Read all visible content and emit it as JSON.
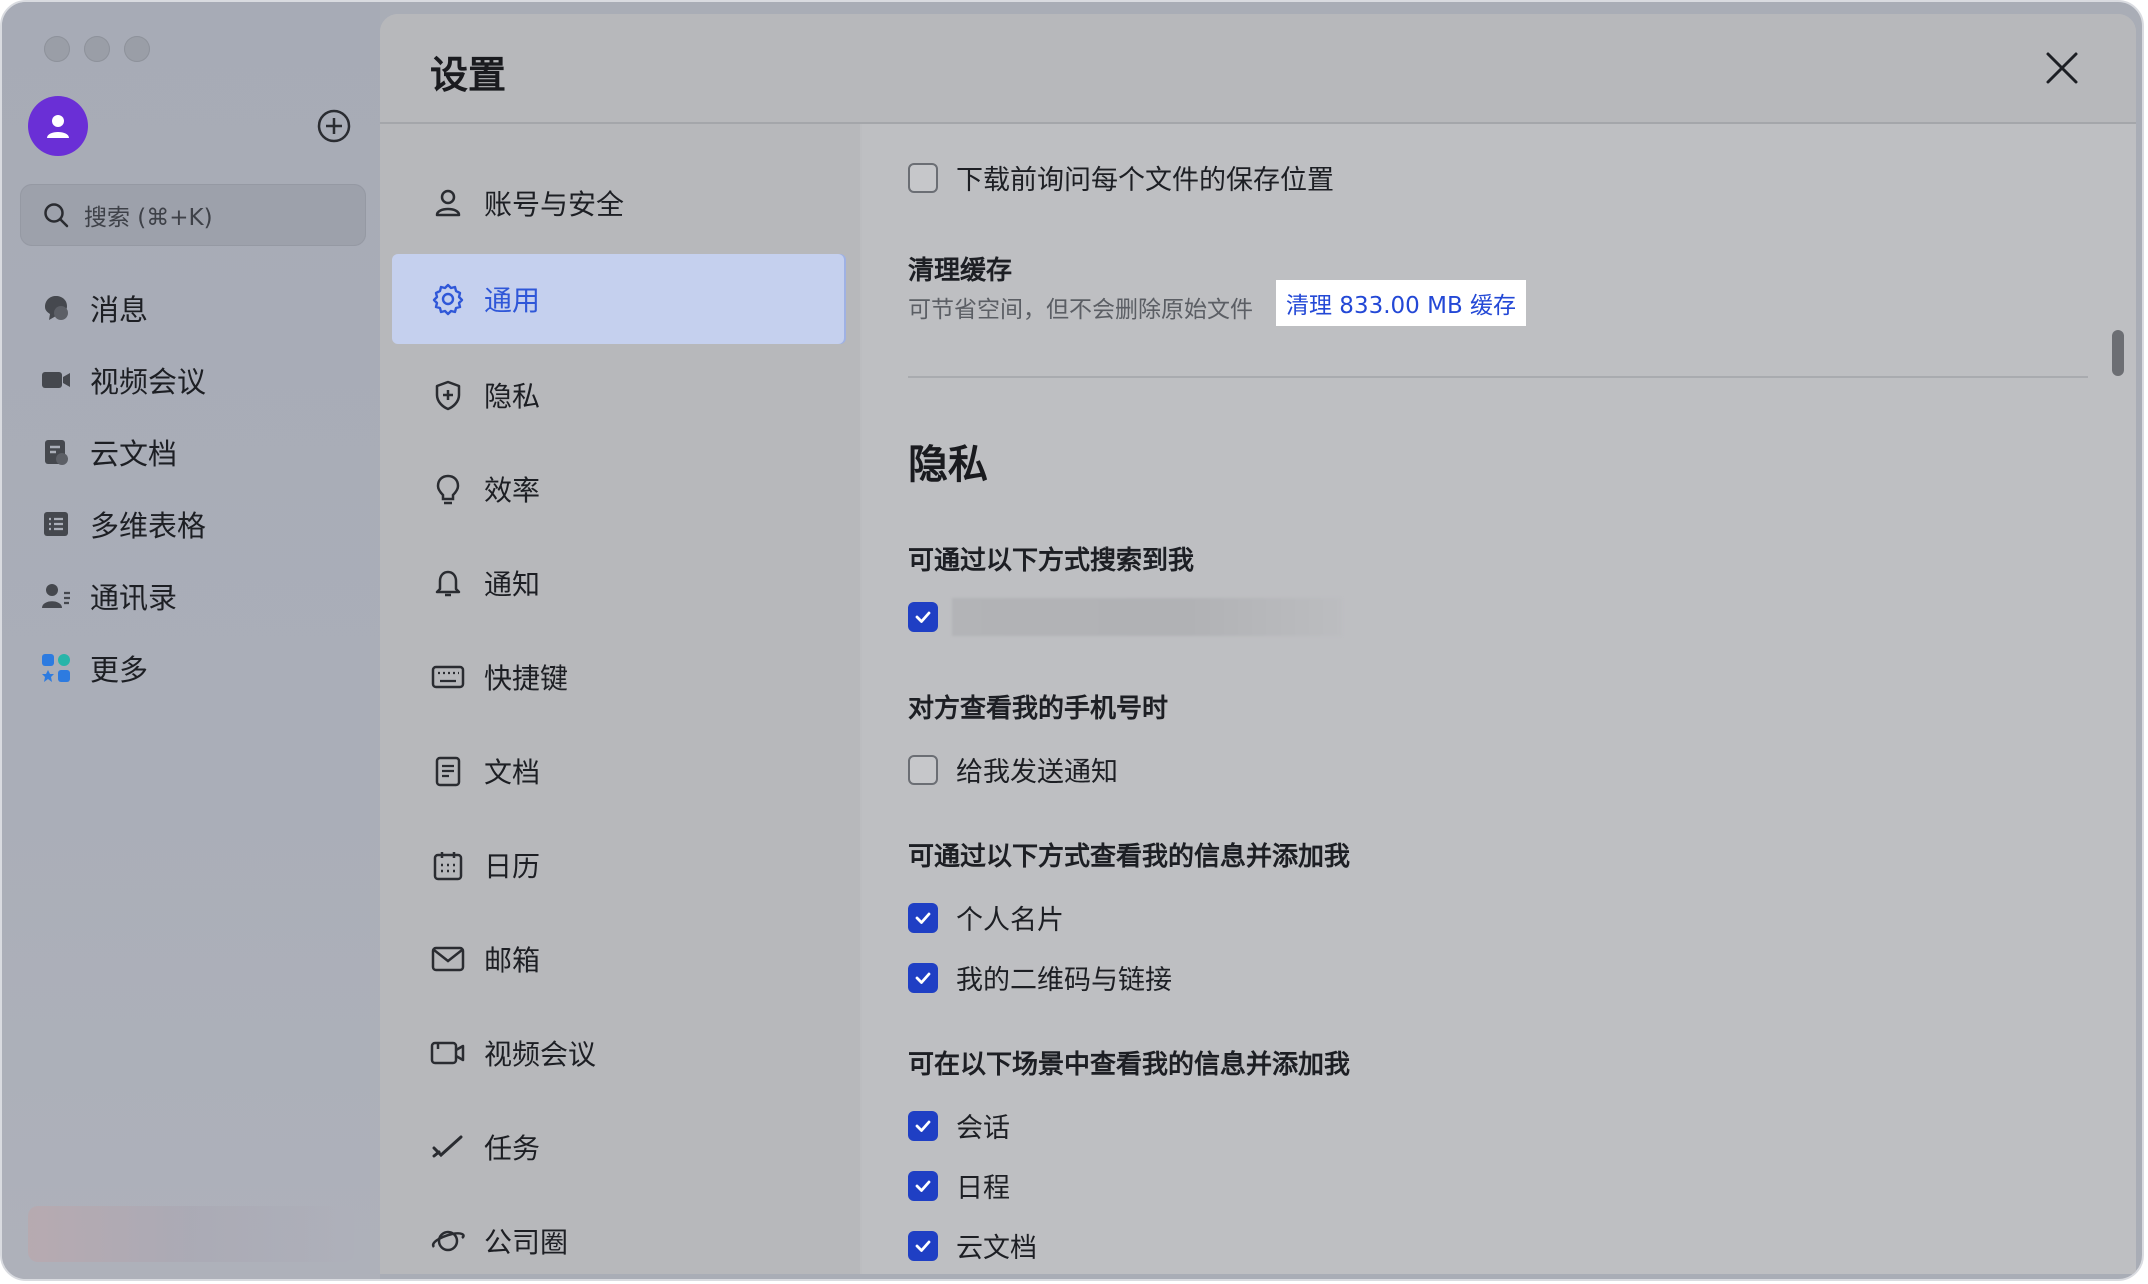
{
  "app": {
    "search_placeholder": "搜索 (⌘+K)",
    "nav": [
      {
        "label": "消息",
        "icon": "chat-bubble-icon"
      },
      {
        "label": "视频会议",
        "icon": "video-camera-icon"
      },
      {
        "label": "云文档",
        "icon": "cloud-document-icon"
      },
      {
        "label": "多维表格",
        "icon": "table-icon"
      },
      {
        "label": "通讯录",
        "icon": "contacts-icon"
      },
      {
        "label": "更多",
        "icon": "more-apps-icon"
      }
    ]
  },
  "settings": {
    "title": "设置",
    "categories": [
      {
        "label": "账号与安全",
        "icon": "person-icon"
      },
      {
        "label": "通用",
        "icon": "gear-icon",
        "active": true
      },
      {
        "label": "隐私",
        "icon": "shield-icon"
      },
      {
        "label": "效率",
        "icon": "lightbulb-icon"
      },
      {
        "label": "通知",
        "icon": "bell-icon"
      },
      {
        "label": "快捷键",
        "icon": "keyboard-icon"
      },
      {
        "label": "文档",
        "icon": "document-icon"
      },
      {
        "label": "日历",
        "icon": "calendar-icon"
      },
      {
        "label": "邮箱",
        "icon": "mail-icon"
      },
      {
        "label": "视频会议",
        "icon": "video-icon"
      },
      {
        "label": "任务",
        "icon": "task-check-icon"
      },
      {
        "label": "公司圈",
        "icon": "planet-icon"
      }
    ],
    "general": {
      "ask_download_location": {
        "label": "下载前询问每个文件的保存位置",
        "checked": false
      },
      "clear_cache": {
        "heading": "清理缓存",
        "hint": "可节省空间，但不会删除原始文件",
        "button": "清理 833.00 MB 缓存"
      }
    },
    "privacy": {
      "title": "隐私",
      "search_me": {
        "heading": "可通过以下方式搜索到我",
        "option": {
          "checked": true
        }
      },
      "phone_view": {
        "heading": "对方查看我的手机号时",
        "notify": {
          "label": "给我发送通知",
          "checked": false
        }
      },
      "add_via": {
        "heading": "可通过以下方式查看我的信息并添加我",
        "options": [
          {
            "label": "个人名片",
            "checked": true
          },
          {
            "label": "我的二维码与链接",
            "checked": true
          }
        ]
      },
      "add_in_scenes": {
        "heading": "可在以下场景中查看我的信息并添加我",
        "options": [
          {
            "label": "会话",
            "checked": true
          },
          {
            "label": "日程",
            "checked": true
          },
          {
            "label": "云文档",
            "checked": true
          }
        ]
      }
    }
  },
  "colors": {
    "accent": "#1f3fc4",
    "link": "#2348d6",
    "avatar": "#6a2fd6",
    "active_category_bg": "#c5d0ee"
  }
}
